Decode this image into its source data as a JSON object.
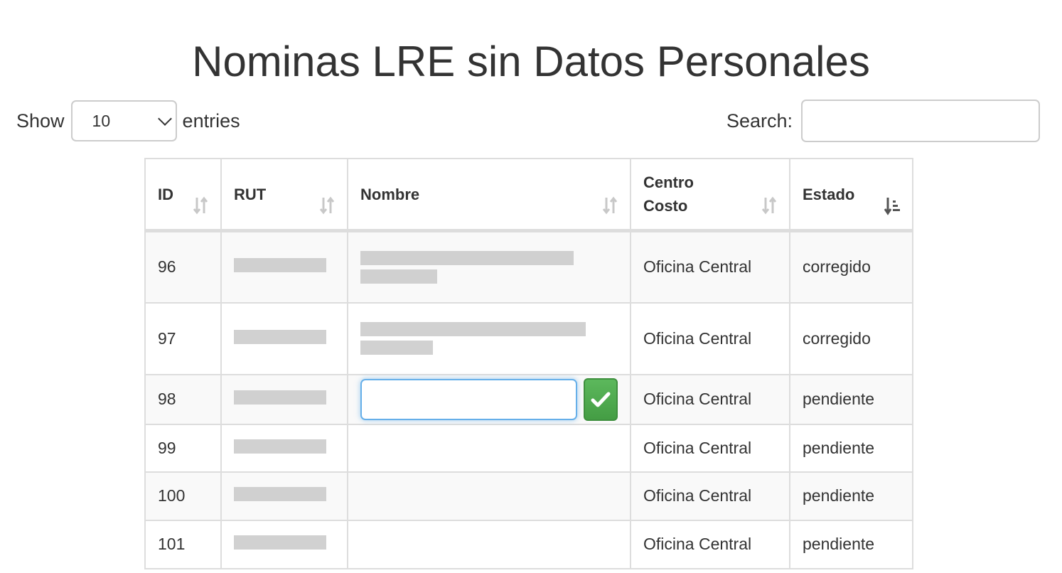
{
  "page": {
    "title": "Nominas LRE sin Datos Personales"
  },
  "length": {
    "show_label": "Show",
    "selected": "10",
    "entries_label": "entries"
  },
  "search": {
    "label": "Search:",
    "value": ""
  },
  "table": {
    "headers": {
      "id": "ID",
      "rut": "RUT",
      "nombre": "Nombre",
      "centro_line1": "Centro",
      "centro_line2": "Costo",
      "estado": "Estado"
    },
    "rows": [
      {
        "id": "96",
        "centro": "Oficina Central",
        "estado": "corregido"
      },
      {
        "id": "97",
        "centro": "Oficina Central",
        "estado": "corregido"
      },
      {
        "id": "98",
        "centro": "Oficina Central",
        "estado": "pendiente"
      },
      {
        "id": "99",
        "centro": "Oficina Central",
        "estado": "pendiente"
      },
      {
        "id": "100",
        "centro": "Oficina Central",
        "estado": "pendiente"
      },
      {
        "id": "101",
        "centro": "Oficina Central",
        "estado": "pendiente"
      }
    ]
  },
  "icons": {
    "sort_unsorted": "sort-both-icon",
    "sort_active": "sort-ascending-icon",
    "confirm": "checkmark-icon",
    "dropdown": "chevron-down-icon"
  },
  "colors": {
    "confirm_button": "#5cb85c",
    "focus_border": "#66afe9",
    "grid_border": "#dddddd"
  }
}
